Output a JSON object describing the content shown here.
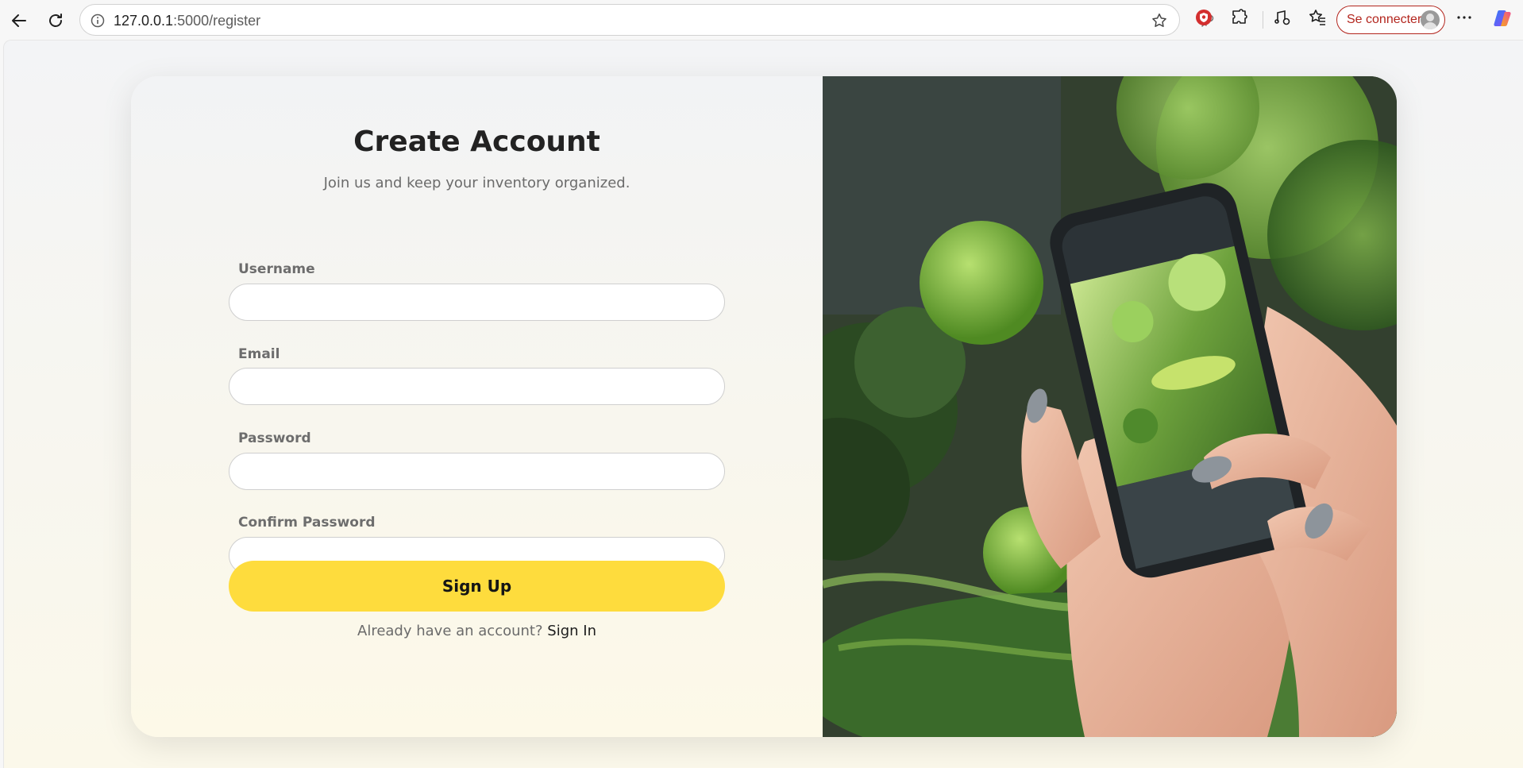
{
  "browser": {
    "url_host": "127.0.0.1",
    "url_path": ":5000/register",
    "signin_label": "Se connecter"
  },
  "icons": {
    "back": "back-arrow-icon",
    "refresh": "refresh-icon",
    "info": "info-icon",
    "key": "key-icon",
    "favorite": "star-icon",
    "shield": "shield-extension-icon",
    "extensions": "puzzle-icon",
    "media": "media-control-icon",
    "favorites": "favorites-icon",
    "menu": "more-icon",
    "copilot": "copilot-icon"
  },
  "form": {
    "title": "Create Account",
    "subtitle": "Join us and keep your inventory organized.",
    "fields": [
      {
        "label": "Username",
        "value": ""
      },
      {
        "label": "Email",
        "value": ""
      },
      {
        "label": "Password",
        "value": ""
      },
      {
        "label": "Confirm Password",
        "value": ""
      }
    ],
    "submit_label": "Sign Up",
    "switch_prompt": "Already have an account?",
    "switch_link": "Sign In"
  },
  "colors": {
    "accent": "#fedc3d",
    "browser_signin": "#b3261e"
  }
}
